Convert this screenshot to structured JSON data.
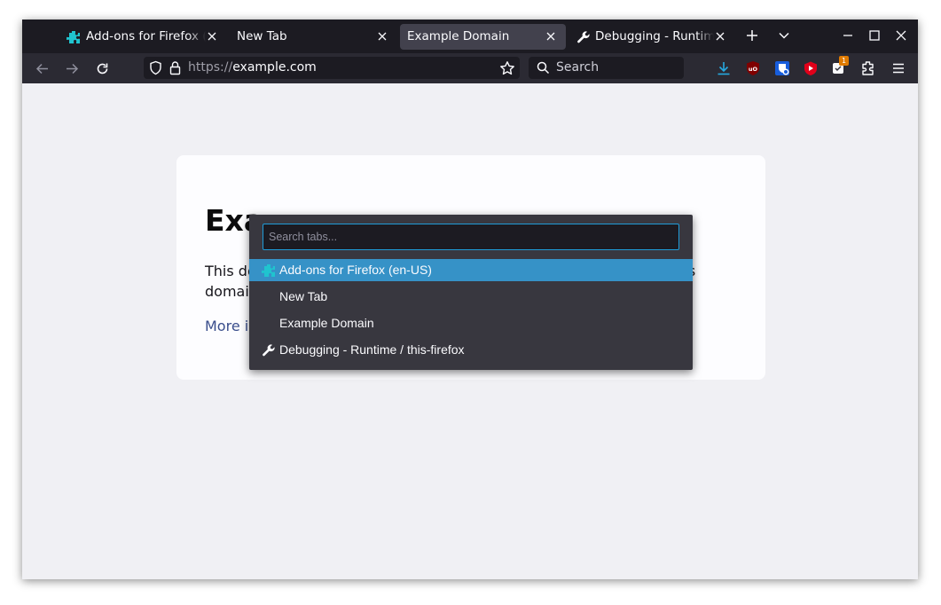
{
  "tabs": [
    {
      "label": "Add-ons for Firefox (e",
      "icon": "addons-puzzle-icon",
      "selected": false
    },
    {
      "label": "New Tab",
      "icon": null,
      "selected": false
    },
    {
      "label": "Example Domain",
      "icon": null,
      "selected": true
    },
    {
      "label": "Debugging - Runtime",
      "icon": "wrench-icon",
      "selected": false
    }
  ],
  "tabbar": {
    "new_tab_icon": "plus-icon",
    "list_all_tabs_icon": "chevron-down-icon"
  },
  "window_controls": [
    "minimize-icon",
    "maximize-icon",
    "close-icon"
  ],
  "navbar": {
    "url_scheme": "https://",
    "url_host": "example.com",
    "search_placeholder": "Search"
  },
  "extensions": [
    "download-icon",
    "ublock-icon",
    "bitwarden-icon",
    "youtube-icon",
    "extension-badge-icon",
    "puzzle-extensions-icon",
    "hamburger-menu-icon"
  ],
  "extension_badge": "1",
  "page": {
    "heading": "Exa",
    "para_start": "This do",
    "para_end": "this",
    "para_line2": "domain",
    "more_link": "More information..."
  },
  "tab_search_panel": {
    "placeholder": "Search tabs...",
    "items": [
      {
        "label": "Add-ons for Firefox (en-US)",
        "icon": "addons-puzzle-icon",
        "active": true
      },
      {
        "label": "New Tab",
        "icon": null,
        "active": false
      },
      {
        "label": "Example Domain",
        "icon": null,
        "active": false
      },
      {
        "label": "Debugging - Runtime / this-firefox",
        "icon": "wrench-icon",
        "active": false
      }
    ]
  },
  "colors": {
    "tabbar": "#1c1b22",
    "navbar": "#2b2a33",
    "accent": "#3692c7",
    "content_bg": "#f0f0f4"
  }
}
